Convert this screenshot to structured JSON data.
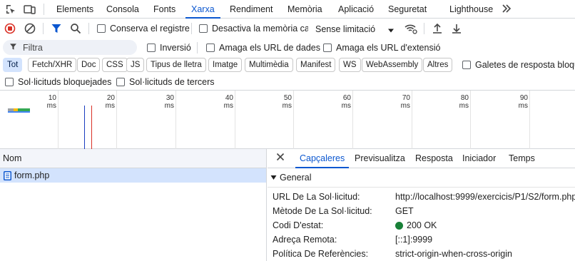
{
  "tabs": [
    "Elements",
    "Consola",
    "Fonts",
    "Xarxa",
    "Rendiment",
    "Memòria",
    "Aplicació",
    "Seguretat",
    "Lighthouse"
  ],
  "active_tab": "Xarxa",
  "more_tabs_icon": "double-chevron-right-icon",
  "toolbar": {
    "preserve_log": "Conserva el registre",
    "disable_cache": "Desactiva la memòria cau",
    "throttling": "Sense limitació"
  },
  "filter": {
    "placeholder": "Filtra",
    "invert": "Inversió",
    "hide_data_urls": "Amaga els URL de dades",
    "hide_extension_urls": "Amaga els URL d'extensió"
  },
  "type_chips": [
    "Tot",
    "Fetch/XHR",
    "Doc",
    "CSS",
    "JS",
    "Tipus de lletra",
    "Imatge",
    "Multimèdia",
    "Manifest",
    "WS",
    "WebAssembly",
    "Altres"
  ],
  "active_chip": "Tot",
  "third_party_cookies": "Galetes de resposta bloquejades",
  "blocked_requests": "Sol·licituds bloquejades",
  "third_party_requests": "Sol·licituds de tercers",
  "timeline_ticks": [
    "10 ms",
    "20 ms",
    "30 ms",
    "40 ms",
    "50 ms",
    "60 ms",
    "70 ms",
    "80 ms",
    "90 ms"
  ],
  "list": {
    "header": "Nom",
    "rows": [
      {
        "name": "form.php",
        "icon": "document-icon"
      }
    ]
  },
  "detail": {
    "tabs": [
      "Capçaleres",
      "Previsualitza",
      "Resposta",
      "Iniciador",
      "Temps"
    ],
    "active_tab": "Capçaleres",
    "section": "General",
    "fields": [
      {
        "key": "URL De La Sol·licitud:",
        "value": "http://localhost:9999/exercicis/P1/S2/form.php"
      },
      {
        "key": "Mètode De La Sol·licitud:",
        "value": "GET"
      },
      {
        "key": "Codi D'estat:",
        "value": "200 OK"
      },
      {
        "key": "Adreça Remota:",
        "value": "[::1]:9999"
      },
      {
        "key": "Política De Referències:",
        "value": "strict-origin-when-cross-origin"
      }
    ]
  },
  "colors": {
    "accent": "#0b57d0",
    "record_red": "#d93025",
    "status_green": "#188038",
    "selected_row": "#d3e3fd",
    "dom_content_loaded": "#1a3dbf",
    "load_event": "#d93025"
  }
}
